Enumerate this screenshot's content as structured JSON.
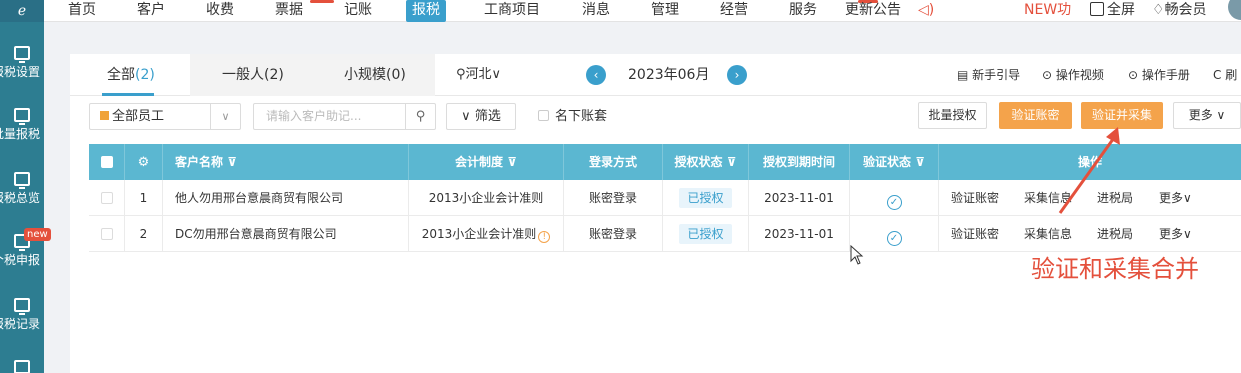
{
  "topnav": {
    "items": [
      "首页",
      "客户",
      "收费",
      "票据",
      "记账",
      "报税",
      "工商项目",
      "消息",
      "管理",
      "经营",
      "服务"
    ],
    "active_index": 5,
    "more_label": "更新公告",
    "promo_label": "NEW功",
    "fullscreen_label": "全屏",
    "member_label": "畅会员"
  },
  "sidebar": {
    "items": [
      {
        "label": "报税设置"
      },
      {
        "label": "批量报税"
      },
      {
        "label": "报税总览"
      },
      {
        "label": "个税申报",
        "badge": "new"
      },
      {
        "label": "报税记录"
      }
    ]
  },
  "tabs": {
    "all_label": "全部",
    "all_count": "(2)",
    "general_label": "一般人(2)",
    "small_label": "小规模(0)",
    "region_label": "河北"
  },
  "period": {
    "month": "2023年06月",
    "prev": "‹",
    "next": "›"
  },
  "helpers": {
    "guide": "新手引导",
    "video": "操作视频",
    "manual": "操作手册",
    "refresh": "刷"
  },
  "toolbar": {
    "staff_select": "全部员工",
    "search_placeholder": "请输入客户助记...",
    "filter_label": "筛选",
    "ledger_checkbox": "名下账套",
    "batch_auth": "批量授权",
    "verify_password": "验证账密",
    "verify_collect": "验证并采集",
    "more": "更多"
  },
  "table": {
    "headers": {
      "name": "客户名称",
      "accounting": "会计制度",
      "login": "登录方式",
      "auth_status": "授权状态",
      "auth_expiry": "授权到期时间",
      "verify_status": "验证状态",
      "ops": "操作"
    },
    "rows": [
      {
        "index": "1",
        "name": "他人勿用邢台意晨商贸有限公司",
        "accounting": "2013小企业会计准则",
        "warn": false,
        "login": "账密登录",
        "auth_status": "已授权",
        "expiry": "2023-11-01"
      },
      {
        "index": "2",
        "name": "DC勿用邢台意晨商贸有限公司",
        "accounting": "2013小企业会计准则",
        "warn": true,
        "login": "账密登录",
        "auth_status": "已授权",
        "expiry": "2023-11-01"
      }
    ],
    "row_ops": {
      "verify": "验证账密",
      "collect": "采集信息",
      "bureau": "进税局",
      "more": "更多"
    }
  },
  "annotation": {
    "text": "验证和采集合并"
  },
  "colors": {
    "accent": "#3a9fcc",
    "sidebar": "#2d7d91",
    "header": "#5bb7d1",
    "orange": "#f4a34b",
    "annotation": "#e4503c"
  }
}
